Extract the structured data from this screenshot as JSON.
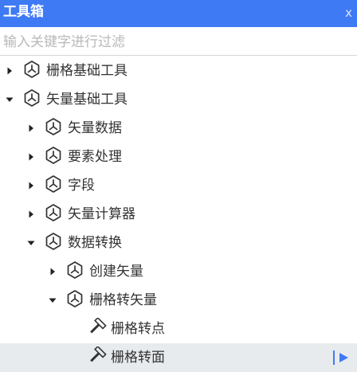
{
  "window": {
    "title": "工具箱",
    "close_glyph": "x"
  },
  "search": {
    "placeholder": "输入关键字进行过滤",
    "value": ""
  },
  "colors": {
    "titlebar": "#3f7af5",
    "selected_row": "#e8ebee",
    "accent": "#3f7af5"
  },
  "tree": [
    {
      "label": "栅格基础工具",
      "level": 0,
      "type": "toolset",
      "expandable": true,
      "expanded": false,
      "icon": "toolbox-icon"
    },
    {
      "label": "矢量基础工具",
      "level": 0,
      "type": "toolset",
      "expandable": true,
      "expanded": true,
      "icon": "toolbox-icon"
    },
    {
      "label": "矢量数据",
      "level": 1,
      "type": "toolset",
      "expandable": true,
      "expanded": false,
      "icon": "toolbox-icon"
    },
    {
      "label": "要素处理",
      "level": 1,
      "type": "toolset",
      "expandable": true,
      "expanded": false,
      "icon": "toolbox-icon"
    },
    {
      "label": "字段",
      "level": 1,
      "type": "toolset",
      "expandable": true,
      "expanded": false,
      "icon": "toolbox-icon"
    },
    {
      "label": "矢量计算器",
      "level": 1,
      "type": "toolset",
      "expandable": true,
      "expanded": false,
      "icon": "toolbox-icon"
    },
    {
      "label": "数据转换",
      "level": 1,
      "type": "toolset",
      "expandable": true,
      "expanded": true,
      "icon": "toolbox-icon"
    },
    {
      "label": "创建矢量",
      "level": 2,
      "type": "toolset",
      "expandable": true,
      "expanded": false,
      "icon": "toolbox-icon"
    },
    {
      "label": "栅格转矢量",
      "level": 2,
      "type": "toolset",
      "expandable": true,
      "expanded": true,
      "icon": "toolbox-icon"
    },
    {
      "label": "栅格转点",
      "level": 3,
      "type": "tool",
      "expandable": false,
      "expanded": false,
      "icon": "hammer-icon"
    },
    {
      "label": "栅格转面",
      "level": 3,
      "type": "tool",
      "expandable": false,
      "expanded": false,
      "icon": "hammer-icon",
      "selected": true,
      "run_icon": "play-icon"
    }
  ]
}
